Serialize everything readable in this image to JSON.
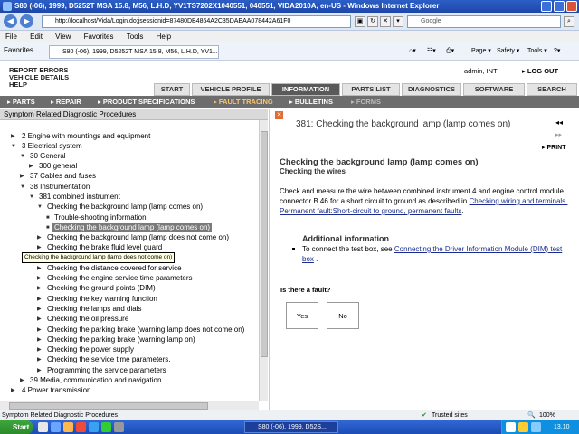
{
  "window": {
    "title": "S80 (-06), 1999, D5252T MSA 15.8, M56, L.H.D, YV1TS7202X1040551, 040551, VIDA2010A, en-US - Windows Internet Explorer"
  },
  "browser": {
    "address": "http://localhost/Vida/Login.do;jsessionid=87480DB4864A2C35DAEAA078442A61F0",
    "search_placeholder": "Google",
    "menu": [
      "File",
      "Edit",
      "View",
      "Favorites",
      "Tools",
      "Help"
    ],
    "favorites_label": "Favorites",
    "tab_title": "S80 (-06), 1999, D5252T MSA 15.8, M56, L.H.D, YV1...",
    "commands": [
      "Page ▾",
      "Safety ▾",
      "Tools ▾"
    ]
  },
  "vida": {
    "top_links": [
      "REPORT ERRORS",
      "VEHICLE DETAILS",
      "HELP"
    ],
    "user": "admin, INT",
    "logout": "LOG OUT",
    "main_tabs": [
      "START",
      "VEHICLE PROFILE",
      "INFORMATION",
      "PARTS LIST",
      "DIAGNOSTICS",
      "SOFTWARE",
      "SEARCH"
    ],
    "active_main_tab": "INFORMATION",
    "sub_nav": [
      "PARTS",
      "REPAIR",
      "PRODUCT SPECIFICATIONS",
      "FAULT TRACING",
      "BULLETINS",
      "FORMS"
    ],
    "active_sub_nav": "FAULT TRACING"
  },
  "left_panel": {
    "title": "Symptom Related Diagnostic Procedures",
    "tree": [
      "2 Engine with mountings and equipment",
      "3 Electrical system",
      "30 General",
      "300 general",
      "37 Cables and fuses",
      "38 Instrumentation",
      "381 combined instrument",
      "Checking the background lamp (lamp comes on)",
      "Trouble-shooting information",
      "Checking the background lamp (lamp comes on)",
      "Checking the background lamp (lamp does not come on)",
      "Checking the brake fluid level guard",
      "Checking the distance covered for service",
      "Checking the engine service time parameters",
      "Checking the ground points (DIM)",
      "Checking the key warning function",
      "Checking the lamps and dials",
      "Checking the oil pressure",
      "Checking the parking brake (warning lamp does not come on)",
      "Checking the parking brake (warning lamp on)",
      "Checking the power supply",
      "Checking the service time parameters.",
      "Programming the service parameters",
      "39 Media, communication and navigation",
      "4 Power transmission"
    ],
    "tooltip": "Checking the background lamp (lamp does not come on)"
  },
  "document": {
    "title": "381: Checking the background lamp (lamp comes on)",
    "print": "PRINT",
    "heading": "Checking the background lamp (lamp comes on)",
    "subheading": "Checking the wires",
    "body": "Check and measure the wire between combined instrument 4 and engine control module connector B 46 for a short circuit to ground as described in",
    "link1": "Checking wiring and terminals. Permanent fault:Short-circuit to ground, permanent faults",
    "body_end": ".",
    "additional_title": "Additional information",
    "bullet_text": "To connect the test box, see",
    "bullet_link": "Connecting the Driver Information Module (DIM) test box",
    "bullet_end": ".",
    "question": "Is there a fault?",
    "yes": "Yes",
    "no": "No"
  },
  "status": {
    "left": "Symptom Related Diagnostic Procedures",
    "zone": "Trusted sites",
    "zoom": "100%"
  },
  "taskbar": {
    "start": "Start",
    "item": "S80 (-06), 1999, D52S...",
    "clock": "13.10"
  }
}
